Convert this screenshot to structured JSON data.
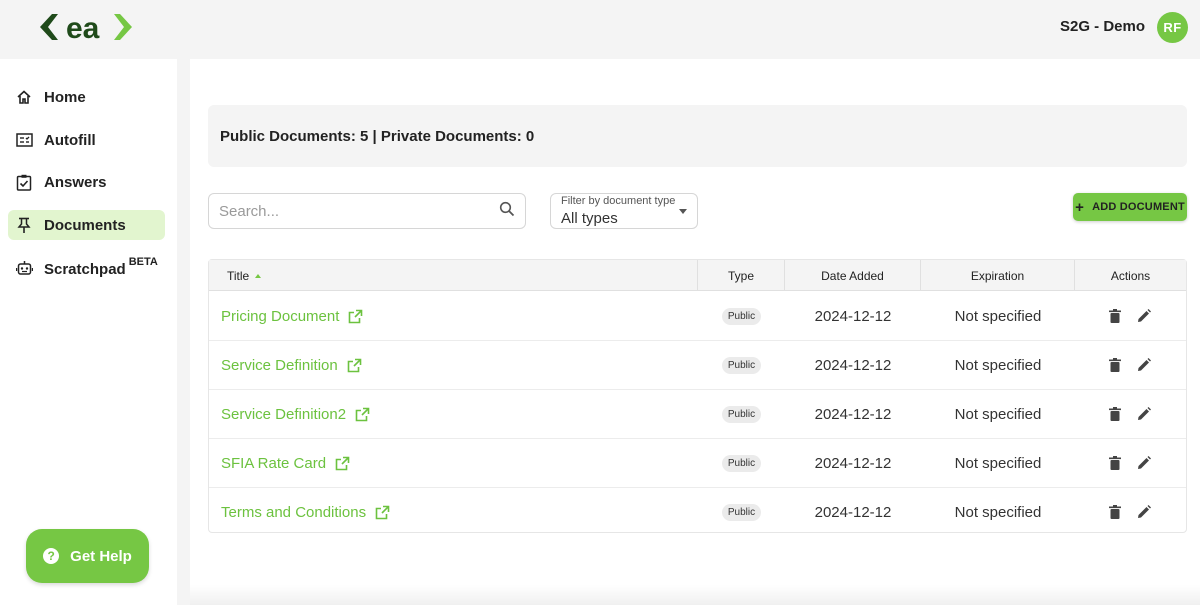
{
  "header": {
    "logo_text": "ea",
    "workspace": "S2G - Demo",
    "avatar_initials": "RF"
  },
  "sidebar": {
    "items": [
      {
        "label": "Home",
        "icon": "home-icon"
      },
      {
        "label": "Autofill",
        "icon": "autofill-icon"
      },
      {
        "label": "Answers",
        "icon": "checklist-icon"
      },
      {
        "label": "Documents",
        "icon": "pin-icon",
        "active": true
      },
      {
        "label": "Scratchpad",
        "icon": "robot-icon",
        "badge": "BETA"
      }
    ],
    "help_label": "Get Help"
  },
  "main": {
    "summary": "Public Documents: 5 | Private Documents: 0",
    "search_placeholder": "Search...",
    "filter": {
      "label": "Filter by document type",
      "value": "All types"
    },
    "add_button": "ADD DOCUMENT",
    "table": {
      "columns": [
        "Title",
        "Type",
        "Date Added",
        "Expiration",
        "Actions"
      ],
      "rows": [
        {
          "title": "Pricing Document",
          "type": "Public",
          "date": "2024-12-12",
          "expiration": "Not specified"
        },
        {
          "title": "Service Definition",
          "type": "Public",
          "date": "2024-12-12",
          "expiration": "Not specified"
        },
        {
          "title": "Service Definition2",
          "type": "Public",
          "date": "2024-12-12",
          "expiration": "Not specified"
        },
        {
          "title": "SFIA Rate Card",
          "type": "Public",
          "date": "2024-12-12",
          "expiration": "Not specified"
        },
        {
          "title": "Terms and Conditions",
          "type": "Public",
          "date": "2024-12-12",
          "expiration": "Not specified"
        }
      ]
    }
  },
  "colors": {
    "brand_green": "#76c744",
    "brand_dark": "#1f4a1a",
    "link_green": "#6cc23f",
    "active_bg": "#e2f5cf"
  }
}
